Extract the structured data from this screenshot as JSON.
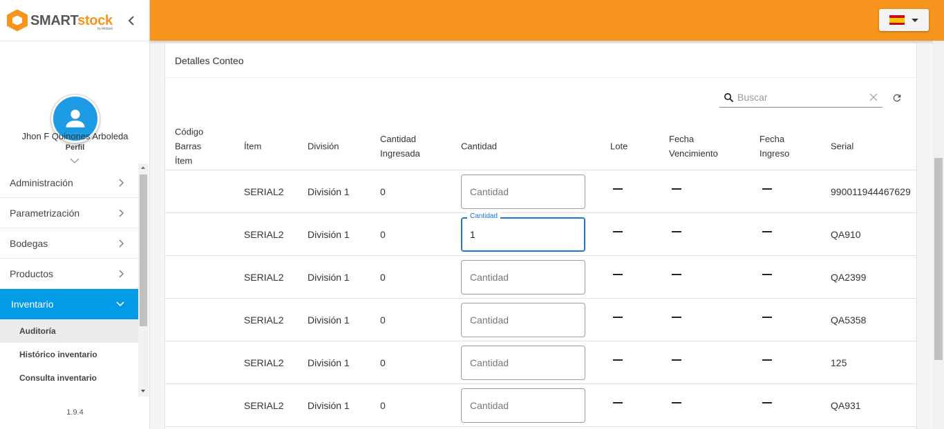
{
  "brand": {
    "name_part1": "SMART",
    "name_part2": "stock",
    "tagline": "by infotrack"
  },
  "user": {
    "name": "Jhon F Quinones Arboleda",
    "role": "Perfil"
  },
  "menu": {
    "items": [
      {
        "label": "Administración"
      },
      {
        "label": "Parametrización"
      },
      {
        "label": "Bodegas"
      },
      {
        "label": "Productos"
      },
      {
        "label": "Inventario"
      }
    ],
    "subitems": [
      {
        "label": "Auditoría"
      },
      {
        "label": "Histórico inventario"
      },
      {
        "label": "Consulta inventario"
      }
    ]
  },
  "version": "1.9.4",
  "colors": {
    "topbar": "#f7941d",
    "active_menu": "#039be5",
    "focus": "#1976d2"
  },
  "language": {
    "flag": "spain-flag-icon"
  },
  "card": {
    "title": "Detalles Conteo"
  },
  "search": {
    "placeholder": "Buscar"
  },
  "table": {
    "headers": {
      "barcode_l1": "Código",
      "barcode_l2": "Barras",
      "barcode_l3": "Ítem",
      "item": "Ítem",
      "division": "División",
      "qty_entered_l1": "Cantidad",
      "qty_entered_l2": "Ingresada",
      "qty": "Cantidad",
      "lot": "Lote",
      "expiry_l1": "Fecha",
      "expiry_l2": "Vencimiento",
      "entry_l1": "Fecha",
      "entry_l2": "Ingreso",
      "serial": "Serial"
    },
    "qty_placeholder": "Cantidad",
    "qty_label": "Cantidad",
    "rows": [
      {
        "item": "SERIAL2",
        "division": "División 1",
        "entered": "0",
        "qty": "",
        "serial": "990011944467629"
      },
      {
        "item": "SERIAL2",
        "division": "División 1",
        "entered": "0",
        "qty": "1",
        "serial": "QA910"
      },
      {
        "item": "SERIAL2",
        "division": "División 1",
        "entered": "0",
        "qty": "",
        "serial": "QA2399"
      },
      {
        "item": "SERIAL2",
        "division": "División 1",
        "entered": "0",
        "qty": "",
        "serial": "QA5358"
      },
      {
        "item": "SERIAL2",
        "division": "División 1",
        "entered": "0",
        "qty": "",
        "serial": "125"
      },
      {
        "item": "SERIAL2",
        "division": "División 1",
        "entered": "0",
        "qty": "",
        "serial": "QA931"
      }
    ]
  }
}
